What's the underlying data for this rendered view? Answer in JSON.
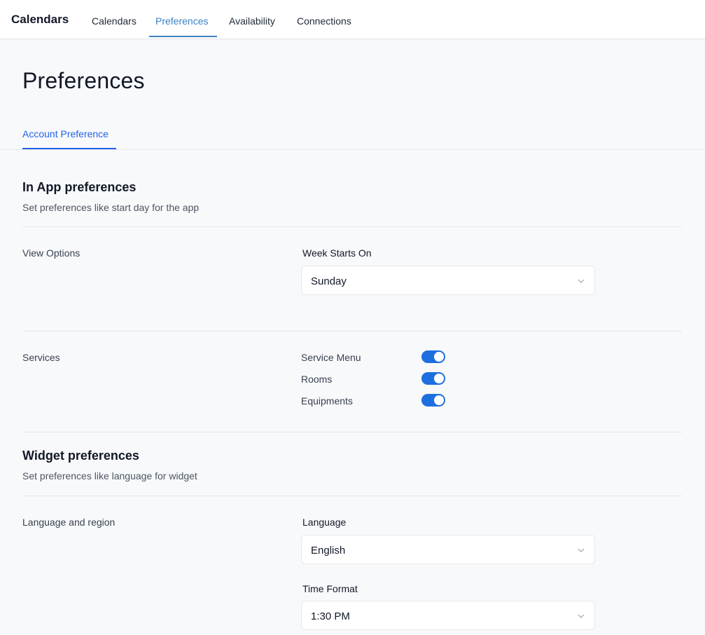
{
  "app": {
    "title": "Calendars"
  },
  "nav": {
    "tabs": [
      {
        "label": "Calendars"
      },
      {
        "label": "Preferences"
      },
      {
        "label": "Availability"
      },
      {
        "label": "Connections"
      }
    ],
    "active": "Preferences"
  },
  "page": {
    "title": "Preferences"
  },
  "subtabs": [
    {
      "label": "Account Preference"
    }
  ],
  "in_app": {
    "title": "In App preferences",
    "description": "Set preferences like start day for the app",
    "view_options": {
      "label": "View Options",
      "week_starts_on": {
        "label": "Week Starts On",
        "value": "Sunday"
      }
    },
    "services": {
      "label": "Services",
      "items": [
        {
          "label": "Service Menu",
          "enabled": true
        },
        {
          "label": "Rooms",
          "enabled": true
        },
        {
          "label": "Equipments",
          "enabled": true
        }
      ]
    }
  },
  "widget": {
    "title": "Widget preferences",
    "description": "Set preferences like language for widget",
    "language_region": {
      "label": "Language and region",
      "language": {
        "label": "Language",
        "value": "English"
      },
      "time_format": {
        "label": "Time Format",
        "value": "1:30 PM"
      }
    }
  },
  "colors": {
    "accent": "#3b82c4",
    "toggle_on": "#1d6fe0",
    "link": "#2563eb"
  },
  "icons": {
    "select_chevron": "chevron-down-icon"
  }
}
